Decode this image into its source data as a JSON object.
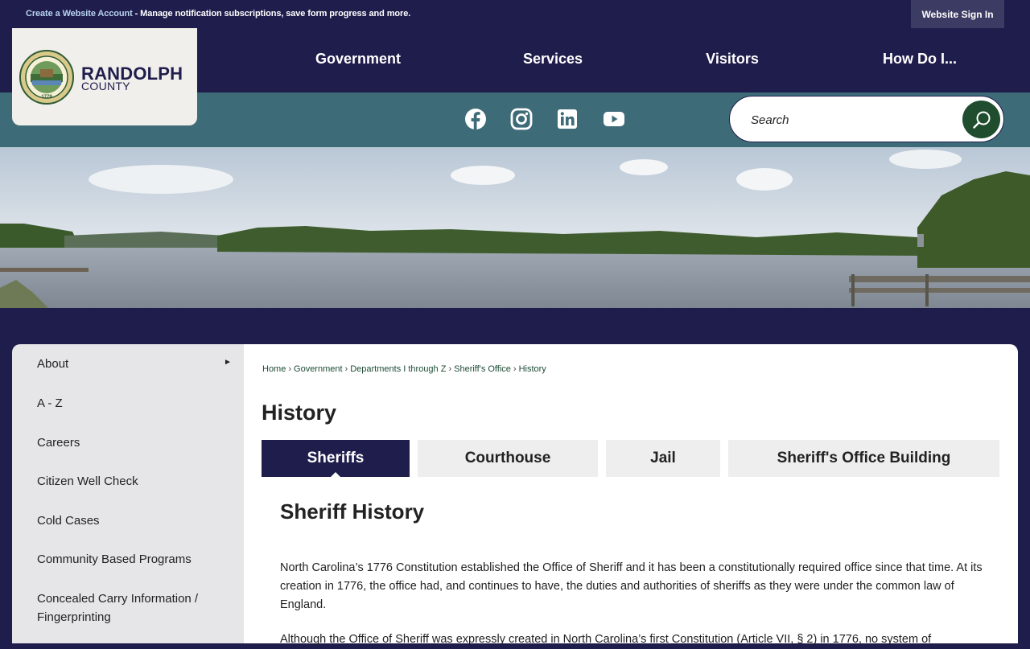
{
  "topbar": {
    "create_account_link": "Create a Website Account",
    "create_account_rest": " - Manage notification subscriptions, save form progress and more.",
    "sign_in": "Website Sign In"
  },
  "logo": {
    "name_line1": "RANDOLPH",
    "name_line2": "COUNTY",
    "seal_text": "RANDOLPH COUNTY, NORTH CAROLINA",
    "seal_year": "1779"
  },
  "nav": {
    "items": [
      {
        "label": "Government"
      },
      {
        "label": "Services"
      },
      {
        "label": "Visitors"
      },
      {
        "label": "How Do I..."
      }
    ]
  },
  "social": [
    "facebook-icon",
    "instagram-icon",
    "linkedin-icon",
    "youtube-icon"
  ],
  "search": {
    "placeholder": "Search"
  },
  "sidebar": {
    "items": [
      {
        "label": "About"
      },
      {
        "label": "A - Z"
      },
      {
        "label": "Careers"
      },
      {
        "label": "Citizen Well Check"
      },
      {
        "label": "Cold Cases"
      },
      {
        "label": "Community Based Programs"
      },
      {
        "label": "Concealed Carry Information / Fingerprinting"
      }
    ]
  },
  "breadcrumb": {
    "items": [
      "Home",
      "Government",
      "Departments I through Z",
      "Sheriff's Office"
    ],
    "current": "History"
  },
  "page": {
    "title": "History",
    "tabs": [
      {
        "label": "Sheriffs",
        "active": true
      },
      {
        "label": "Courthouse",
        "active": false
      },
      {
        "label": "Jail",
        "active": false
      },
      {
        "label": "Sheriff's Office Building",
        "active": false
      }
    ],
    "section_title": "Sheriff History",
    "paragraph1": "North Carolina’s 1776 Constitution established the Office of Sheriff and it has been a constitutionally required office since that time. At its creation in 1776, the office had, and continues to have, the duties and authorities of sheriffs as they were under the common law of England.",
    "paragraph2": "Although the Office of Sheriff was expressly created in North Carolina’s first Constitution (Article VII, § 2) in 1776, no system of"
  },
  "colors": {
    "navy": "#1f1d4c",
    "teal": "#3e6b78",
    "green": "#1f4d2e"
  }
}
